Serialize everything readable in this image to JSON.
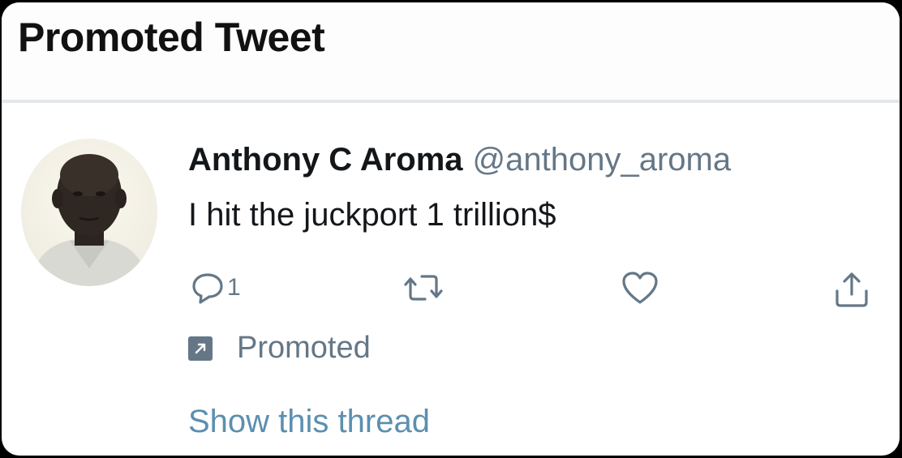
{
  "header": {
    "title": "Promoted Tweet"
  },
  "tweet": {
    "author": {
      "name": "Anthony C Aroma",
      "handle": "@anthony_aroma"
    },
    "text": "I hit the juckport 1 trillion$",
    "actions": {
      "reply_count": "1",
      "retweet_icon": "retweet-icon",
      "like_icon": "heart-icon",
      "share_icon": "share-icon"
    },
    "promoted_label": "Promoted",
    "show_thread": "Show this thread"
  },
  "colors": {
    "text_primary": "#14171a",
    "text_secondary": "#657786",
    "link": "#5c8fb0",
    "divider": "#e4e8ea"
  }
}
